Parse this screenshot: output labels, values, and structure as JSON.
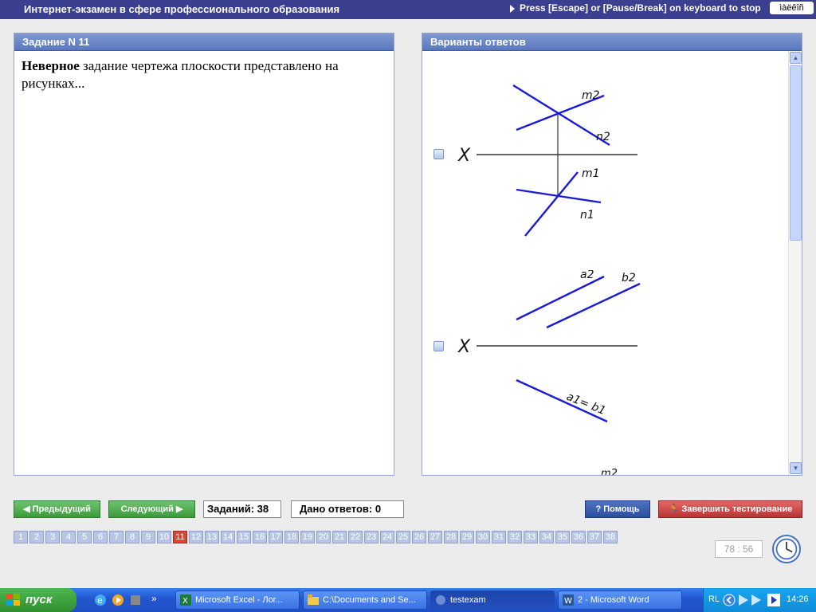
{
  "window": {
    "title": "Интернет-экзамен в сфере профессионального образования",
    "escape_hint": "Press [Escape] or [Pause/Break] on keyboard to stop",
    "lang_indicator": "ìàëêîñ"
  },
  "task": {
    "header": "Задание N 11",
    "text_bold": "Неверное",
    "text_rest": " задание чертежа плоскости представлено на рисунках..."
  },
  "answers": {
    "header": "Варианты ответов",
    "options": [
      {
        "axis_label": "X",
        "labels": [
          "m2",
          "n2",
          "m1",
          "n1"
        ]
      },
      {
        "axis_label": "X",
        "labels": [
          "a2",
          "b2",
          "a1= b1"
        ]
      },
      {
        "labels": [
          "m2"
        ]
      }
    ]
  },
  "controls": {
    "prev_label": "Предыдущий",
    "next_label": "Следующий",
    "tasks_count": "Заданий: 38",
    "answers_given": "Дано ответов: 0",
    "help_label": "Помощь",
    "finish_label": "Завершить тестирование",
    "timer": "78 : 56"
  },
  "pager": {
    "pages": [
      "1",
      "2",
      "3",
      "4",
      "5",
      "6",
      "7",
      "8",
      "9",
      "10",
      "11",
      "12",
      "13",
      "14",
      "15",
      "16",
      "17",
      "18",
      "19",
      "20",
      "21",
      "22",
      "23",
      "24",
      "25",
      "26",
      "27",
      "28",
      "29",
      "30",
      "31",
      "32",
      "33",
      "34",
      "35",
      "36",
      "37",
      "38"
    ],
    "current": "11"
  },
  "taskbar": {
    "start_label": "пуск",
    "overflow": "»",
    "tasks": [
      {
        "label": "Microsoft Excel - Лог...",
        "icon": "excel-icon"
      },
      {
        "label": "C:\\Documents and Se...",
        "icon": "folder-icon"
      },
      {
        "label": "testexam",
        "icon": "testexam-icon"
      },
      {
        "label": "2 - Microsoft Word",
        "icon": "word-icon"
      }
    ],
    "tray_lang": "RL",
    "clock": "14:26"
  }
}
